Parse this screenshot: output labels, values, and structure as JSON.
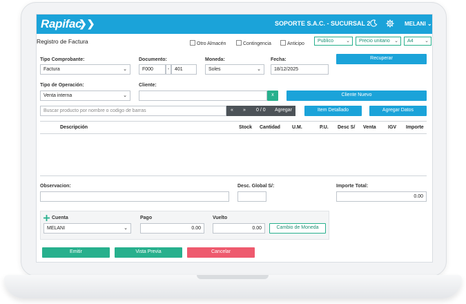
{
  "app": {
    "logo": "Rapifac",
    "company": "SOPORTE S.A.C. - SUCURSAL 2",
    "user": "MELANI"
  },
  "page": {
    "title": "Registro de Factura"
  },
  "options": {
    "otro_almacen": "Otro Almacén",
    "contingencia": "Contingencia",
    "anticipo": "Anticipo"
  },
  "toolbar_selects": {
    "price_list": "Publico",
    "price_mode": "Precio unitario",
    "format": "A4"
  },
  "form": {
    "tipo_comprobante_label": "Tipo Comprobante:",
    "tipo_comprobante_value": "Factura",
    "documento_label": "Documento:",
    "serie": "F000",
    "separator": "-",
    "numero": "401",
    "moneda_label": "Moneda:",
    "moneda_value": "Soles",
    "fecha_label": "Fecha:",
    "fecha_value": "18/12/2025",
    "recuperar": "Recuperar",
    "tipo_operacion_label": "Tipo de Operación:",
    "tipo_operacion_value": "Venta interna",
    "cliente_label": "Cliente:",
    "cliente_value": "",
    "clear_x": "x",
    "cliente_nuevo": "Cliente Nuevo"
  },
  "product_bar": {
    "search_placeholder": "Buscar producto por nombre o codigo de barras",
    "prev": "«",
    "next": "»",
    "counter": "0 / 0",
    "agregar": "Agregar",
    "item_detallado": "Item Detallado",
    "agregar_datos": "Agregar Datos"
  },
  "table": {
    "columns": [
      "Descripción",
      "Stock",
      "Cantidad",
      "U.M.",
      "P.U.",
      "Desc S/",
      "Venta",
      "IGV",
      "Importe"
    ]
  },
  "summary": {
    "observacion_label": "Observacion:",
    "desc_global_label": "Desc. Global S/:",
    "importe_total_label": "Importe Total:",
    "importe_total_value": "0.00"
  },
  "payment": {
    "cuenta_label": "Cuenta",
    "cuenta_value": "MELANI",
    "pago_label": "Pago",
    "pago_value": "0.00",
    "vuelto_label": "Vuelto",
    "vuelto_value": "0.00",
    "cambio_moneda": "Cambio de Moneda"
  },
  "actions": {
    "emitir": "Emitir",
    "vista_previa": "Vista Previa",
    "cancelar": "Cancelar"
  },
  "colors": {
    "primary": "#1ba3d9",
    "success": "#27b08d",
    "danger": "#ee5a6e",
    "dark": "#4d5358"
  },
  "icons": {
    "theme": "moon-icon",
    "settings": "gear-icon",
    "add": "plus-icon",
    "dropdown": "chevron-down-icon"
  }
}
